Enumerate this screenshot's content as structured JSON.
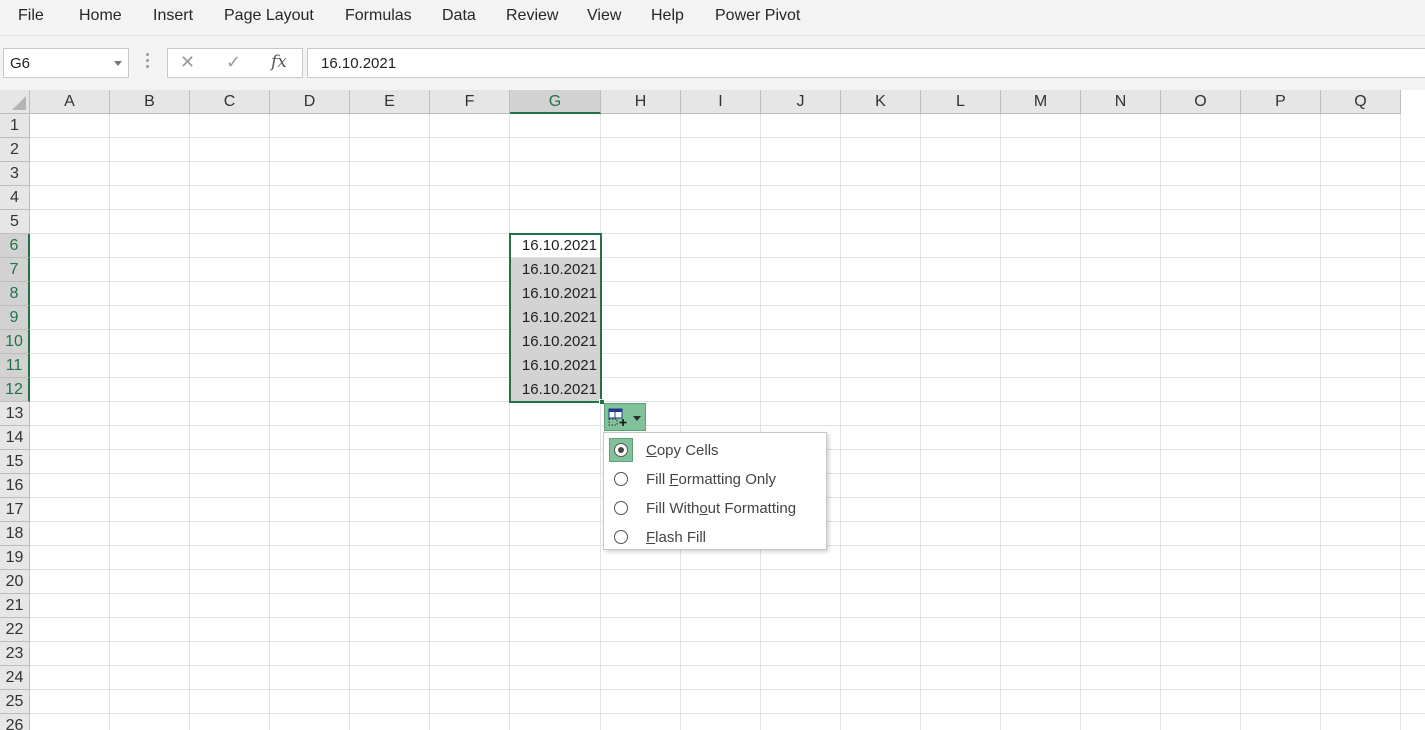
{
  "menu": {
    "tabs": [
      "File",
      "Home",
      "Insert",
      "Page Layout",
      "Formulas",
      "Data",
      "Review",
      "View",
      "Help",
      "Power Pivot"
    ]
  },
  "formula_bar": {
    "name_box": "G6",
    "cancel_glyph": "✕",
    "enter_glyph": "✓",
    "fx_label": "fx",
    "formula": "16.10.2021"
  },
  "grid": {
    "columns": [
      "A",
      "B",
      "C",
      "D",
      "E",
      "F",
      "G",
      "H",
      "I",
      "J",
      "K",
      "L",
      "M",
      "N",
      "O",
      "P",
      "Q"
    ],
    "rows": [
      "1",
      "2",
      "3",
      "4",
      "5",
      "6",
      "7",
      "8",
      "9",
      "10",
      "11",
      "12",
      "13",
      "14",
      "15",
      "16",
      "17",
      "18",
      "19",
      "20",
      "21",
      "22",
      "23",
      "24",
      "25",
      "26"
    ],
    "selected_column": "G",
    "selected_rows": [
      "6",
      "7",
      "8",
      "9",
      "10",
      "11",
      "12"
    ],
    "active_cell": "G6",
    "cells_G": [
      "16.10.2021",
      "16.10.2021",
      "16.10.2021",
      "16.10.2021",
      "16.10.2021",
      "16.10.2021",
      "16.10.2021"
    ]
  },
  "autofill_menu": {
    "button_icon": "autofill-options-icon",
    "selected_index": 0,
    "items": [
      {
        "before": "",
        "accel": "C",
        "after": "opy Cells"
      },
      {
        "before": "Fill ",
        "accel": "F",
        "after": "ormatting Only"
      },
      {
        "before": "Fill With",
        "accel": "o",
        "after": "ut Formatting"
      },
      {
        "before": "",
        "accel": "F",
        "after": "lash Fill"
      }
    ]
  },
  "colors": {
    "accent": "#217346",
    "autofill_highlight": "#82c29b",
    "fill_selection": "#d3d3d3"
  }
}
